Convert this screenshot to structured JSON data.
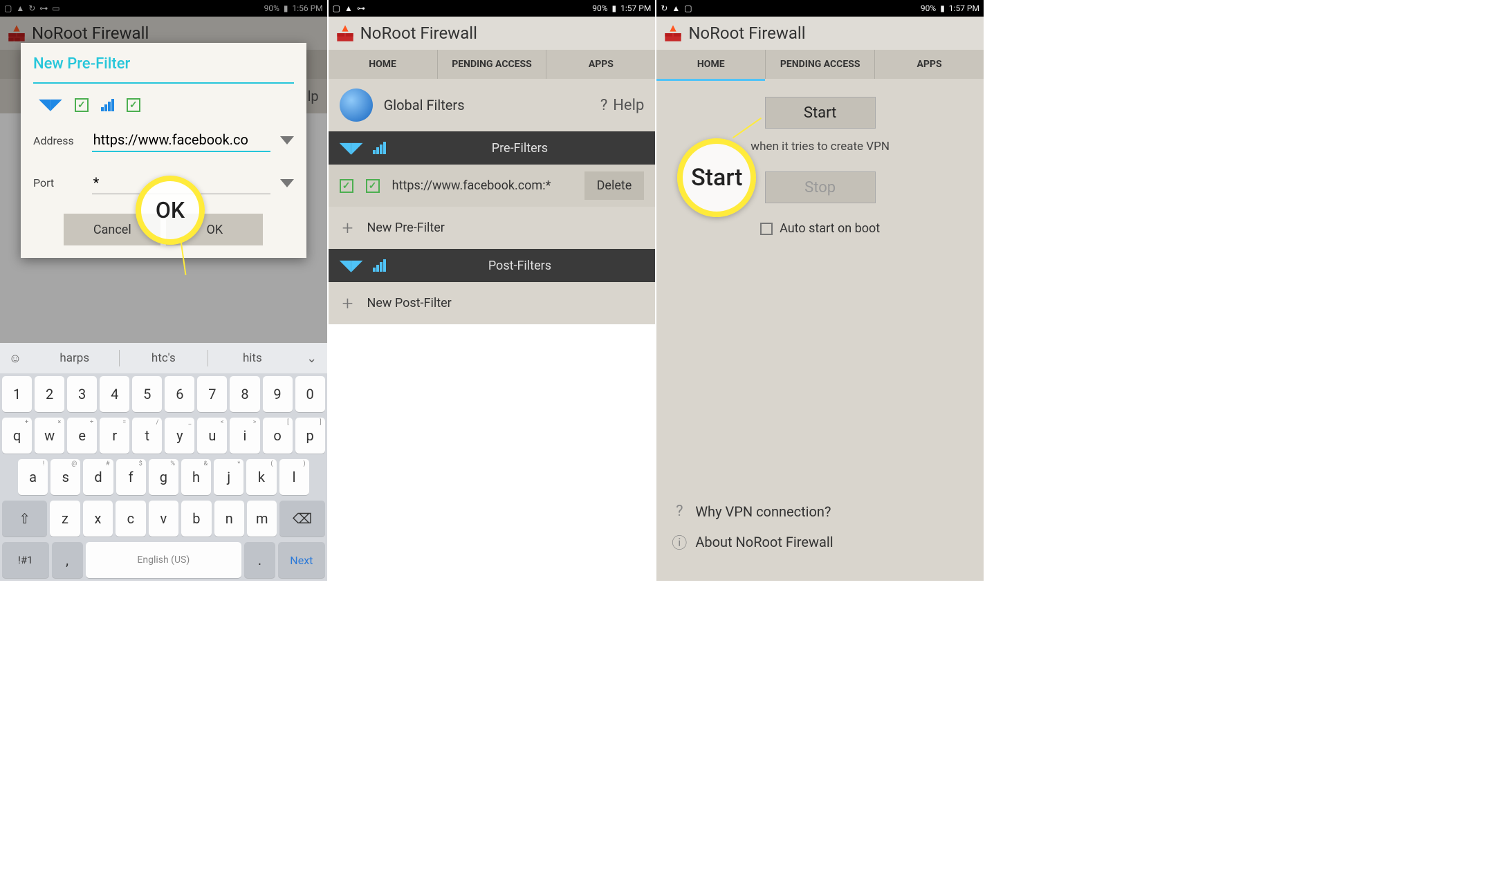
{
  "status": {
    "battery": "90%",
    "time1": "1:56 PM",
    "time2": "1:57 PM"
  },
  "app": {
    "name": "NoRoot Firewall"
  },
  "tabs": {
    "home": "HOME",
    "pending": "PENDING ACCESS",
    "apps": "APPS"
  },
  "dialog": {
    "title": "New Pre-Filter",
    "address_label": "Address",
    "address_value": "https://www.facebook.co",
    "port_label": "Port",
    "port_value": "*",
    "cancel": "Cancel",
    "ok": "OK"
  },
  "highlight1": "OK",
  "keyboard": {
    "suggestions": [
      "harps",
      "htc's",
      "hits"
    ],
    "row1": [
      "1",
      "2",
      "3",
      "4",
      "5",
      "6",
      "7",
      "8",
      "9",
      "0"
    ],
    "row2": [
      [
        "q",
        "+"
      ],
      [
        "w",
        "×"
      ],
      [
        "e",
        "÷"
      ],
      [
        "r",
        "="
      ],
      [
        "t",
        "/"
      ],
      [
        "y",
        "_"
      ],
      [
        "u",
        "<"
      ],
      [
        "i",
        ">"
      ],
      [
        "o",
        "["
      ],
      [
        "p",
        "]"
      ]
    ],
    "row3": [
      [
        "a",
        "!"
      ],
      [
        "s",
        "@"
      ],
      [
        "d",
        "#"
      ],
      [
        "f",
        "$"
      ],
      [
        "g",
        "%"
      ],
      [
        "h",
        "&"
      ],
      [
        "j",
        "*"
      ],
      [
        "k",
        "("
      ],
      [
        "l",
        ")"
      ]
    ],
    "row4": [
      "z",
      "x",
      "c",
      "v",
      "b",
      "n",
      "m"
    ],
    "sym": "!#1",
    "lang": "English (US)",
    "next": "Next"
  },
  "panel2": {
    "global": "Global Filters",
    "help": "Help",
    "pre": "Pre-Filters",
    "filter_url": "https://www.facebook.com:*",
    "delete": "Delete",
    "new_pre": "New Pre-Filter",
    "post": "Post-Filters",
    "new_post": "New Post-Filter"
  },
  "panel3": {
    "start": "Start",
    "vpn_text": "when it tries to create VPN",
    "stop": "Stop",
    "auto": "Auto start on boot",
    "why": "Why VPN connection?",
    "about": "About NoRoot Firewall",
    "highlight": "Start"
  }
}
